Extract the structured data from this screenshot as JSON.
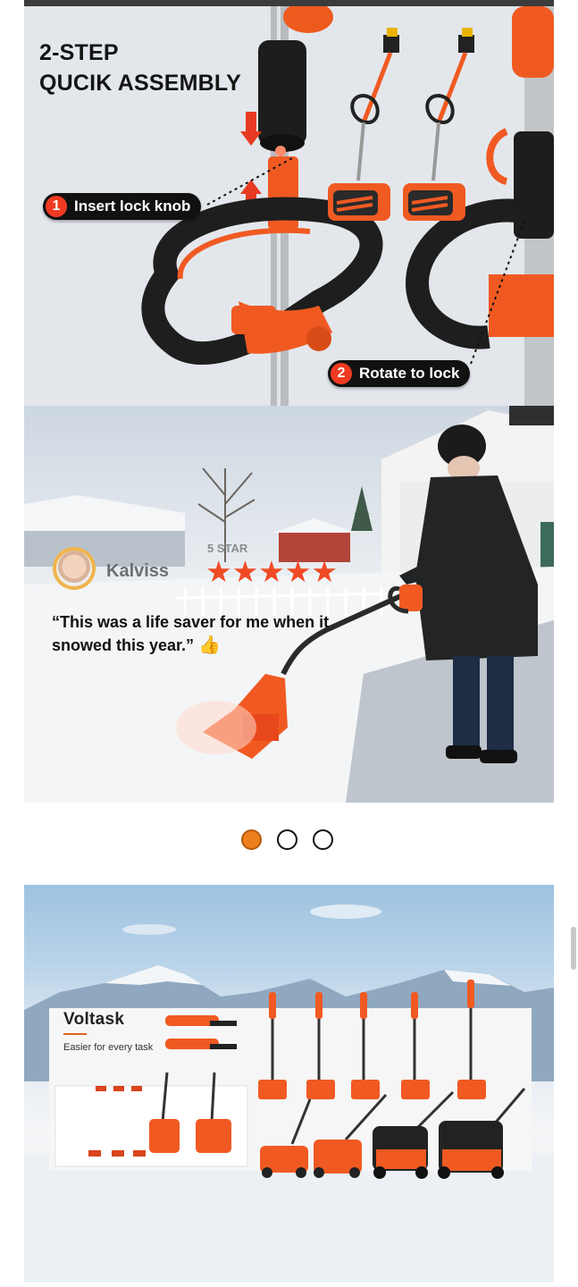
{
  "assembly": {
    "title_line1": "2-STEP",
    "title_line2": "QUCIK ASSEMBLY",
    "step1": {
      "num": "1",
      "label": "Insert lock knob"
    },
    "step2": {
      "num": "2",
      "label": "Rotate to lock"
    }
  },
  "review": {
    "reviewer": "Kalviss",
    "rating_label": "5 STAR",
    "stars": "★★★★★",
    "quote": "“This was a life saver for me when it snowed this year.”",
    "thumb_icon": "thumbs-up-icon"
  },
  "carousel": {
    "slides": 3,
    "active_index": 0,
    "active_color": "#ef7f1e"
  },
  "product_line": {
    "brand": "Voltask",
    "tagline": "Easier for every task"
  },
  "colors": {
    "accent": "#ef5a24",
    "dark": "#111111"
  }
}
